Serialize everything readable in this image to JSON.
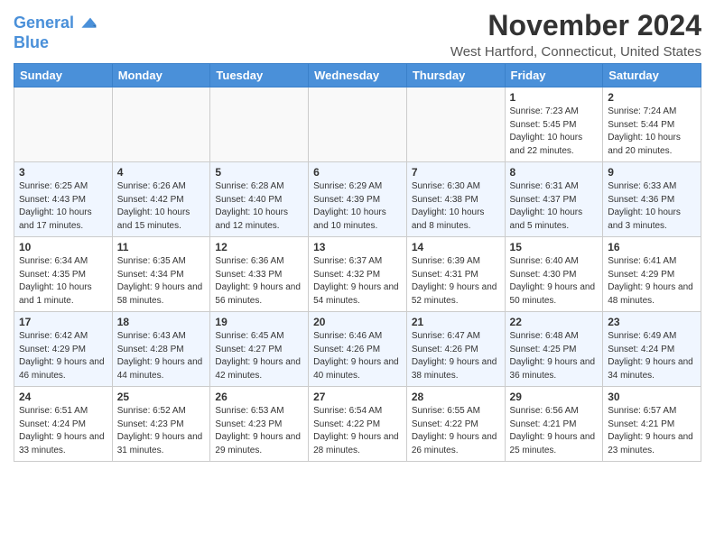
{
  "logo": {
    "line1": "General",
    "line2": "Blue"
  },
  "title": "November 2024",
  "location": "West Hartford, Connecticut, United States",
  "days_of_week": [
    "Sunday",
    "Monday",
    "Tuesday",
    "Wednesday",
    "Thursday",
    "Friday",
    "Saturday"
  ],
  "weeks": [
    [
      {
        "day": "",
        "info": ""
      },
      {
        "day": "",
        "info": ""
      },
      {
        "day": "",
        "info": ""
      },
      {
        "day": "",
        "info": ""
      },
      {
        "day": "",
        "info": ""
      },
      {
        "day": "1",
        "info": "Sunrise: 7:23 AM\nSunset: 5:45 PM\nDaylight: 10 hours and 22 minutes."
      },
      {
        "day": "2",
        "info": "Sunrise: 7:24 AM\nSunset: 5:44 PM\nDaylight: 10 hours and 20 minutes."
      }
    ],
    [
      {
        "day": "3",
        "info": "Sunrise: 6:25 AM\nSunset: 4:43 PM\nDaylight: 10 hours and 17 minutes."
      },
      {
        "day": "4",
        "info": "Sunrise: 6:26 AM\nSunset: 4:42 PM\nDaylight: 10 hours and 15 minutes."
      },
      {
        "day": "5",
        "info": "Sunrise: 6:28 AM\nSunset: 4:40 PM\nDaylight: 10 hours and 12 minutes."
      },
      {
        "day": "6",
        "info": "Sunrise: 6:29 AM\nSunset: 4:39 PM\nDaylight: 10 hours and 10 minutes."
      },
      {
        "day": "7",
        "info": "Sunrise: 6:30 AM\nSunset: 4:38 PM\nDaylight: 10 hours and 8 minutes."
      },
      {
        "day": "8",
        "info": "Sunrise: 6:31 AM\nSunset: 4:37 PM\nDaylight: 10 hours and 5 minutes."
      },
      {
        "day": "9",
        "info": "Sunrise: 6:33 AM\nSunset: 4:36 PM\nDaylight: 10 hours and 3 minutes."
      }
    ],
    [
      {
        "day": "10",
        "info": "Sunrise: 6:34 AM\nSunset: 4:35 PM\nDaylight: 10 hours and 1 minute."
      },
      {
        "day": "11",
        "info": "Sunrise: 6:35 AM\nSunset: 4:34 PM\nDaylight: 9 hours and 58 minutes."
      },
      {
        "day": "12",
        "info": "Sunrise: 6:36 AM\nSunset: 4:33 PM\nDaylight: 9 hours and 56 minutes."
      },
      {
        "day": "13",
        "info": "Sunrise: 6:37 AM\nSunset: 4:32 PM\nDaylight: 9 hours and 54 minutes."
      },
      {
        "day": "14",
        "info": "Sunrise: 6:39 AM\nSunset: 4:31 PM\nDaylight: 9 hours and 52 minutes."
      },
      {
        "day": "15",
        "info": "Sunrise: 6:40 AM\nSunset: 4:30 PM\nDaylight: 9 hours and 50 minutes."
      },
      {
        "day": "16",
        "info": "Sunrise: 6:41 AM\nSunset: 4:29 PM\nDaylight: 9 hours and 48 minutes."
      }
    ],
    [
      {
        "day": "17",
        "info": "Sunrise: 6:42 AM\nSunset: 4:29 PM\nDaylight: 9 hours and 46 minutes."
      },
      {
        "day": "18",
        "info": "Sunrise: 6:43 AM\nSunset: 4:28 PM\nDaylight: 9 hours and 44 minutes."
      },
      {
        "day": "19",
        "info": "Sunrise: 6:45 AM\nSunset: 4:27 PM\nDaylight: 9 hours and 42 minutes."
      },
      {
        "day": "20",
        "info": "Sunrise: 6:46 AM\nSunset: 4:26 PM\nDaylight: 9 hours and 40 minutes."
      },
      {
        "day": "21",
        "info": "Sunrise: 6:47 AM\nSunset: 4:26 PM\nDaylight: 9 hours and 38 minutes."
      },
      {
        "day": "22",
        "info": "Sunrise: 6:48 AM\nSunset: 4:25 PM\nDaylight: 9 hours and 36 minutes."
      },
      {
        "day": "23",
        "info": "Sunrise: 6:49 AM\nSunset: 4:24 PM\nDaylight: 9 hours and 34 minutes."
      }
    ],
    [
      {
        "day": "24",
        "info": "Sunrise: 6:51 AM\nSunset: 4:24 PM\nDaylight: 9 hours and 33 minutes."
      },
      {
        "day": "25",
        "info": "Sunrise: 6:52 AM\nSunset: 4:23 PM\nDaylight: 9 hours and 31 minutes."
      },
      {
        "day": "26",
        "info": "Sunrise: 6:53 AM\nSunset: 4:23 PM\nDaylight: 9 hours and 29 minutes."
      },
      {
        "day": "27",
        "info": "Sunrise: 6:54 AM\nSunset: 4:22 PM\nDaylight: 9 hours and 28 minutes."
      },
      {
        "day": "28",
        "info": "Sunrise: 6:55 AM\nSunset: 4:22 PM\nDaylight: 9 hours and 26 minutes."
      },
      {
        "day": "29",
        "info": "Sunrise: 6:56 AM\nSunset: 4:21 PM\nDaylight: 9 hours and 25 minutes."
      },
      {
        "day": "30",
        "info": "Sunrise: 6:57 AM\nSunset: 4:21 PM\nDaylight: 9 hours and 23 minutes."
      }
    ]
  ]
}
